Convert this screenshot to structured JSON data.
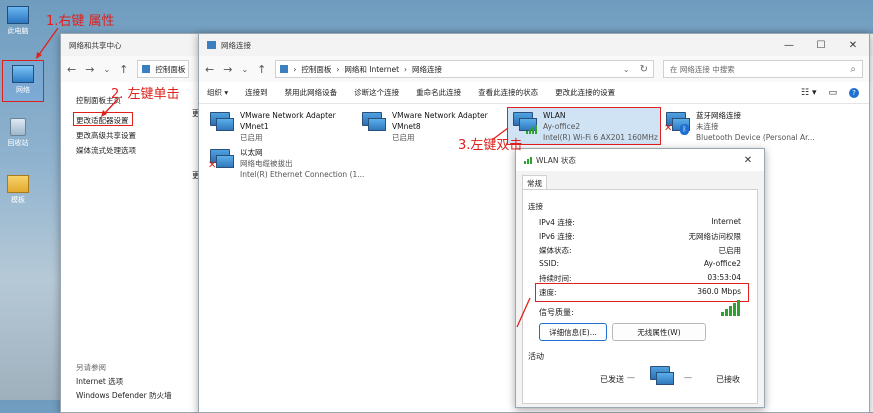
{
  "desktop": {
    "icons": [
      {
        "label": "此电脑",
        "icon": "computer-icon"
      },
      {
        "label": "网络",
        "icon": "network-icon"
      },
      {
        "label": "回收站",
        "icon": "recycle-bin-icon"
      },
      {
        "label": "模板",
        "icon": "folder-icon"
      }
    ]
  },
  "annotations": {
    "step1": "1.右键 属性",
    "step2": "2. 左键单击",
    "step3": "3.左键双击"
  },
  "nsc_window": {
    "title": "网络和共享中心",
    "address": "控制面板",
    "nav": {
      "home": "控制面板主页",
      "change_adapter": "更改适配器设置",
      "change_sharing": "更改高级共享设置",
      "media_streaming": "媒体流式处理选项",
      "see_also": "另请参阅",
      "internet_options": "Internet 选项",
      "defender": "Windows Defender 防火墙",
      "partial_1": "更",
      "partial_2": "更"
    }
  },
  "nc_window": {
    "title": "网络连接",
    "breadcrumb": [
      "控制面板",
      "网络和 Internet",
      "网络连接"
    ],
    "search_placeholder": "在 网络连接 中搜索",
    "toolbar": [
      "组织 ▾",
      "连接到",
      "禁用此网络设备",
      "诊断这个连接",
      "重命名此连接",
      "查看此连接的状态",
      "更改此连接的设置"
    ],
    "adapters": [
      {
        "name": "VMware Network Adapter VMnet1",
        "line1": "VMware Network Adapter",
        "line2": "VMnet1",
        "status": "已启用",
        "device": ""
      },
      {
        "name": "VMware Network Adapter VMnet8",
        "line1": "VMware Network Adapter",
        "line2": "VMnet8",
        "status": "已启用",
        "device": ""
      },
      {
        "name": "WLAN",
        "status": "Ay-office2",
        "device": "Intel(R) Wi-Fi 6 AX201 160MHz"
      },
      {
        "name": "蓝牙网络连接",
        "status": "未连接",
        "device": "Bluetooth Device (Personal Ar..."
      },
      {
        "name": "以太网",
        "status": "网络电缆被拔出",
        "device": "Intel(R) Ethernet Connection (1..."
      }
    ]
  },
  "wlan_status": {
    "title": "WLAN 状态",
    "tab": "常规",
    "connection_heading": "连接",
    "rows": [
      {
        "label": "IPv4 连接:",
        "value": "Internet"
      },
      {
        "label": "IPv6 连接:",
        "value": "无网络访问权限"
      },
      {
        "label": "媒体状态:",
        "value": "已启用"
      },
      {
        "label": "SSID:",
        "value": "Ay-office2"
      },
      {
        "label": "持续时间:",
        "value": "03:53:04"
      },
      {
        "label": "速度:",
        "value": "360.0 Mbps"
      }
    ],
    "signal_label": "信号质量:",
    "details_button": "详细信息(E)...",
    "wireless_props_button": "无线属性(W)",
    "activity_heading": "活动",
    "sent_label": "已发送",
    "received_label": "已接收",
    "colors": {
      "accent": "#e0201c",
      "signal": "#2ea12e",
      "selected": "#cfe3f5"
    }
  }
}
